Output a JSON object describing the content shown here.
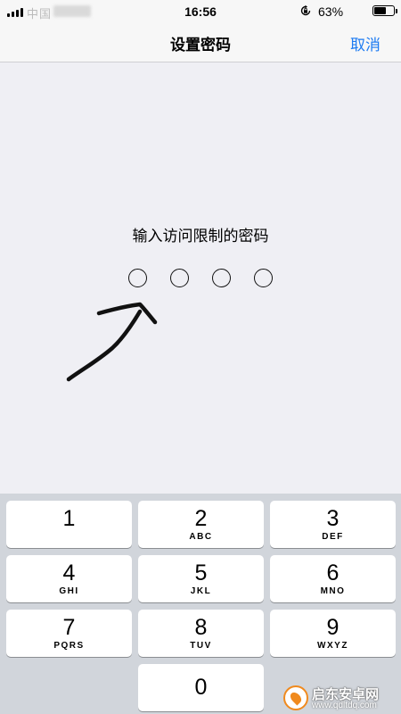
{
  "status_bar": {
    "carrier": "中国",
    "time": "16:56",
    "battery_percent": "63%",
    "battery_level": 0.63,
    "icons": [
      "signal-icon",
      "rotation-lock-icon",
      "battery-icon"
    ]
  },
  "nav": {
    "title": "设置密码",
    "cancel_label": "取消"
  },
  "prompt": "输入访问限制的密码",
  "passcode": {
    "length": 4,
    "filled": 0
  },
  "keypad": [
    {
      "num": "1",
      "letters": ""
    },
    {
      "num": "2",
      "letters": "ABC"
    },
    {
      "num": "3",
      "letters": "DEF"
    },
    {
      "num": "4",
      "letters": "GHI"
    },
    {
      "num": "5",
      "letters": "JKL"
    },
    {
      "num": "6",
      "letters": "MNO"
    },
    {
      "num": "7",
      "letters": "PQRS"
    },
    {
      "num": "8",
      "letters": "TUV"
    },
    {
      "num": "9",
      "letters": "WXYZ"
    },
    {
      "num": "0",
      "letters": ""
    }
  ],
  "watermark": {
    "name": "启东安卓网",
    "url": "www.qdltdq.com"
  },
  "colors": {
    "accent": "#1d7bf2",
    "background": "#efeff4",
    "keypad_background": "#d1d5db"
  }
}
